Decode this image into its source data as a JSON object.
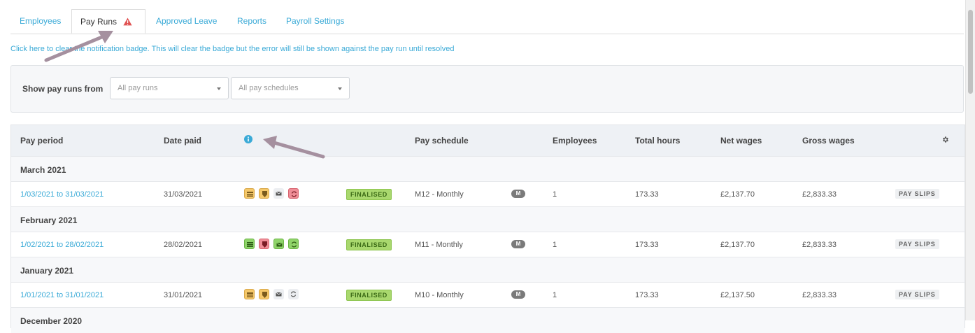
{
  "tabs": {
    "employees": "Employees",
    "pay_runs": "Pay Runs",
    "approved_leave": "Approved Leave",
    "reports": "Reports",
    "payroll_settings": "Payroll Settings"
  },
  "notice": "Click here to clear the notification badge. This will clear the badge but the error will still be shown against the pay run until resolved",
  "filter": {
    "label": "Show pay runs from",
    "pay_runs_placeholder": "All pay runs",
    "pay_schedules_placeholder": "All pay schedules"
  },
  "table": {
    "headers": {
      "pay_period": "Pay period",
      "date_paid": "Date paid",
      "pay_schedule": "Pay schedule",
      "employees": "Employees",
      "total_hours": "Total hours",
      "net_wages": "Net wages",
      "gross_wages": "Gross wages"
    },
    "groups": [
      {
        "label": "March 2021",
        "row": {
          "pay_period": "1/03/2021 to 31/03/2021",
          "date_paid": "31/03/2021",
          "status": "FINALISED",
          "pay_schedule": "M12 - Monthly",
          "schedule_badge": "M",
          "employees": "1",
          "total_hours": "173.33",
          "net_wages": "£2,137.70",
          "gross_wages": "£2,833.33",
          "action": "PAY SLIPS"
        }
      },
      {
        "label": "February 2021",
        "row": {
          "pay_period": "1/02/2021 to 28/02/2021",
          "date_paid": "28/02/2021",
          "status": "FINALISED",
          "pay_schedule": "M11 - Monthly",
          "schedule_badge": "M",
          "employees": "1",
          "total_hours": "173.33",
          "net_wages": "£2,137.70",
          "gross_wages": "£2,833.33",
          "action": "PAY SLIPS"
        }
      },
      {
        "label": "January 2021",
        "row": {
          "pay_period": "1/01/2021 to 31/01/2021",
          "date_paid": "31/01/2021",
          "status": "FINALISED",
          "pay_schedule": "M10 - Monthly",
          "schedule_badge": "M",
          "employees": "1",
          "total_hours": "173.33",
          "net_wages": "£2,137.50",
          "gross_wages": "£2,833.33",
          "action": "PAY SLIPS"
        }
      },
      {
        "label": "December 2020"
      }
    ]
  },
  "colors": {
    "link": "#3aaad7",
    "finalised": "#a9d86e",
    "warning": "#e05252",
    "status_yellow": "#f5c86a",
    "status_green": "#8fd46a",
    "status_red": "#ef8d97",
    "status_grey": "#eceef1"
  },
  "icons": [
    "warning-triangle-icon",
    "info-icon",
    "gear-icon",
    "hmrc-icon",
    "pension-icon",
    "email-icon",
    "sync-icon",
    "caret-down-icon"
  ]
}
